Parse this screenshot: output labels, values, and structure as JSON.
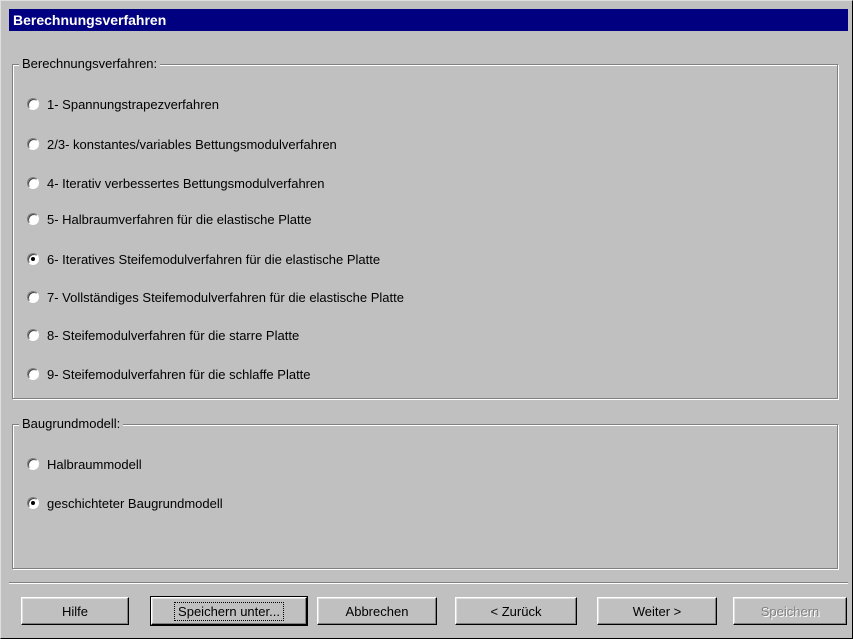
{
  "window": {
    "title": "Berechnungsverfahren"
  },
  "method_group": {
    "label": "Berechnungsverfahren:",
    "options": [
      {
        "label": "1- Spannungstrapezverfahren",
        "checked": false
      },
      {
        "label": "2/3- konstantes/variables Bettungsmodulverfahren",
        "checked": false
      },
      {
        "label": "4- Iterativ verbessertes Bettungsmodulverfahren",
        "checked": false
      },
      {
        "label": "5- Halbraumverfahren für die elastische Platte",
        "checked": false
      },
      {
        "label": "6- Iteratives Steifemodulverfahren für die elastische Platte",
        "checked": true
      },
      {
        "label": "7- Vollständiges Steifemodulverfahren für die elastische Platte",
        "checked": false
      },
      {
        "label": "8- Steifemodulverfahren für die starre Platte",
        "checked": false
      },
      {
        "label": "9- Steifemodulverfahren für die schlaffe Platte",
        "checked": false
      }
    ]
  },
  "soil_group": {
    "label": "Baugrundmodell:",
    "options": [
      {
        "label": "Halbraummodell",
        "checked": false
      },
      {
        "label": "geschichteter Baugrundmodell",
        "checked": true
      }
    ]
  },
  "buttons": {
    "help": "Hilfe",
    "save_as": "Speichern unter...",
    "cancel": "Abbrechen",
    "back": "< Zurück",
    "next": "Weiter >",
    "save": "Speichern"
  }
}
